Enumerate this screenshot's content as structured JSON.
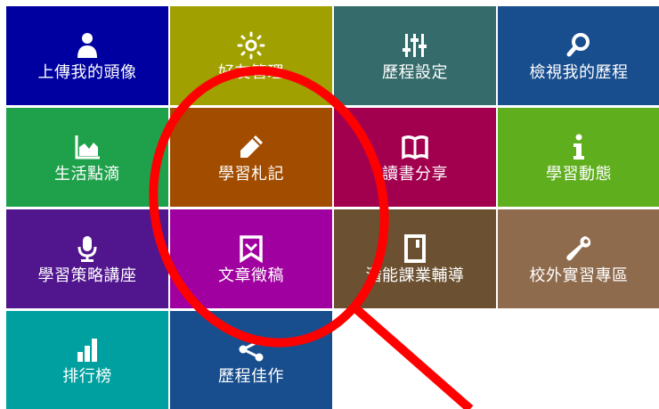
{
  "tiles": [
    {
      "label": "上傳我的頭像",
      "icon": "user-icon",
      "color": "#0000a0"
    },
    {
      "label": "好友管理",
      "icon": "gear-icon",
      "color": "#a0a000"
    },
    {
      "label": "歷程設定",
      "icon": "sliders-icon",
      "color": "#366b6b"
    },
    {
      "label": "檢視我的歷程",
      "icon": "magnifier-icon",
      "color": "#184e8e"
    },
    {
      "label": "生活點滴",
      "icon": "area-chart-icon",
      "color": "#1fa14c"
    },
    {
      "label": "學習札記",
      "icon": "pencil-icon",
      "color": "#a24c00"
    },
    {
      "label": "讀書分享",
      "icon": "book-icon",
      "color": "#a2004e"
    },
    {
      "label": "學習動態",
      "icon": "info-icon",
      "color": "#5fae1e"
    },
    {
      "label": "學習策略講座",
      "icon": "microphone-icon",
      "color": "#51168e"
    },
    {
      "label": "文章徵稿",
      "icon": "bookmark-book-icon",
      "color": "#a000a0"
    },
    {
      "label": "潛能課業輔導",
      "icon": "notebook-icon",
      "color": "#6b5131"
    },
    {
      "label": "校外實習專區",
      "icon": "wrench-icon",
      "color": "#8f6b4d"
    },
    {
      "label": "排行榜",
      "icon": "bar-chart-icon",
      "color": "#00a0a0"
    },
    {
      "label": "歷程佳作",
      "icon": "share-icon",
      "color": "#184e8e"
    }
  ],
  "annotation": {
    "color": "#ff0000"
  }
}
